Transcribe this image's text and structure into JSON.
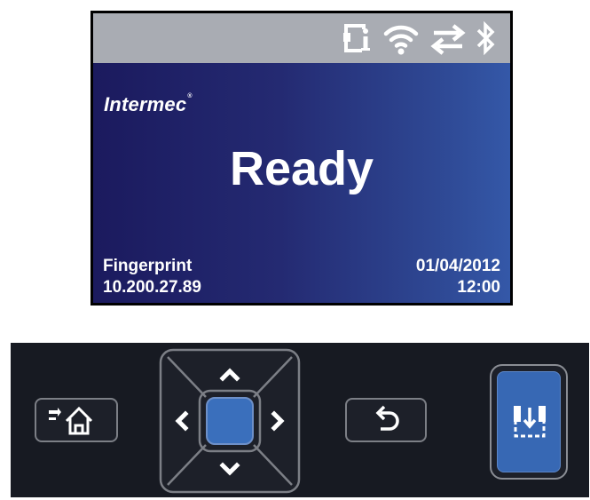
{
  "screen": {
    "status_icons": [
      "printer-info-icon",
      "wifi-icon",
      "transfer-arrows-icon",
      "bluetooth-icon"
    ],
    "brand": "Intermec",
    "brand_mark": "®",
    "status": "Ready",
    "mode": "Fingerprint",
    "ip_address": "10.200.27.89",
    "date": "01/04/2012",
    "time": "12:00",
    "colors": {
      "status_bar": "#a9acb3",
      "display_start": "#1b1a5e",
      "display_end": "#3458a8",
      "text": "#ffffff"
    }
  },
  "panel": {
    "buttons": [
      "home-button",
      "navigation-pad",
      "back-button",
      "feed-button"
    ],
    "nav_arrows": [
      "up",
      "down",
      "left",
      "right"
    ],
    "colors": {
      "background": "#171a22",
      "accent": "#3a6fbc",
      "outline": "#7c7f86"
    }
  }
}
